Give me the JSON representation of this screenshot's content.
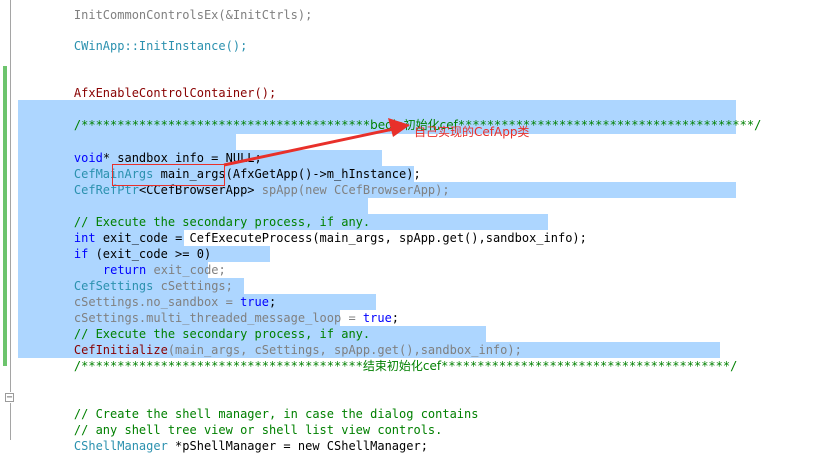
{
  "code": {
    "line_partial": "InitCommonControlsEx(&InitCtrls);",
    "line_winapp": "CWinApp::InitInstance();",
    "line_afx": "AfxEnableControlContainer();",
    "banner_begin_stars_left": "/****************************************",
    "banner_begin_text": "begin初始化cef",
    "banner_begin_stars_right": "*****************************************/",
    "sandbox_kw": "void",
    "sandbox_rest": "* sandbox_info = NULL;",
    "mainargs_type": "CefMainArgs",
    "mainargs_rest": " main_args(AfxGetApp()->m_hInstance);",
    "refptr_type": "CefRefPtr",
    "refptr_template": "<CCefBrowserApp>",
    "refptr_rest": " spApp(new CCefBrowserApp);",
    "comment_secondary_1": "// Execute the secondary process, if any.",
    "exitcode_kw": "int",
    "exitcode_rest": " exit_code = CefExecuteProcess(main_args, spApp.get(),sandbox_info);",
    "if_kw": "if",
    "if_rest": " (exit_code >= 0)",
    "return_kw": "return",
    "return_rest": " exit_code;",
    "settings_type": "CefSettings",
    "settings_rest": " cSettings;",
    "nosandbox_pre": "cSettings.no_sandbox = ",
    "nosandbox_val": "true",
    "multithread_pre": "cSettings.multi_threaded_message_loop = ",
    "multithread_val": "true",
    "comment_secondary_2": "// Execute the secondary process, if any.",
    "init_fn": "CefInitialize",
    "init_rest": "(main_args, cSettings, spApp.get(),sandbox_info);",
    "banner_end_stars_left": "/***************************************",
    "banner_end_text": "结束初始化cef",
    "banner_end_stars_right": "****************************************/",
    "comment_shell_1": "// Create the shell manager, in case the dialog contains",
    "comment_shell_2": "// any shell tree view or shell list view controls.",
    "shellmgr_type": "CShellManager",
    "shellmgr_rest": " *pShellManager = new CShellManager;"
  },
  "annotation": {
    "label": "自己实现的CefApp类",
    "color": "#e8302a"
  },
  "colors": {
    "keyword": "#0000ff",
    "type": "#2b91af",
    "function": "#880000",
    "comment": "#008000",
    "selection": "#add6ff",
    "change_bar": "#6dc46d"
  }
}
